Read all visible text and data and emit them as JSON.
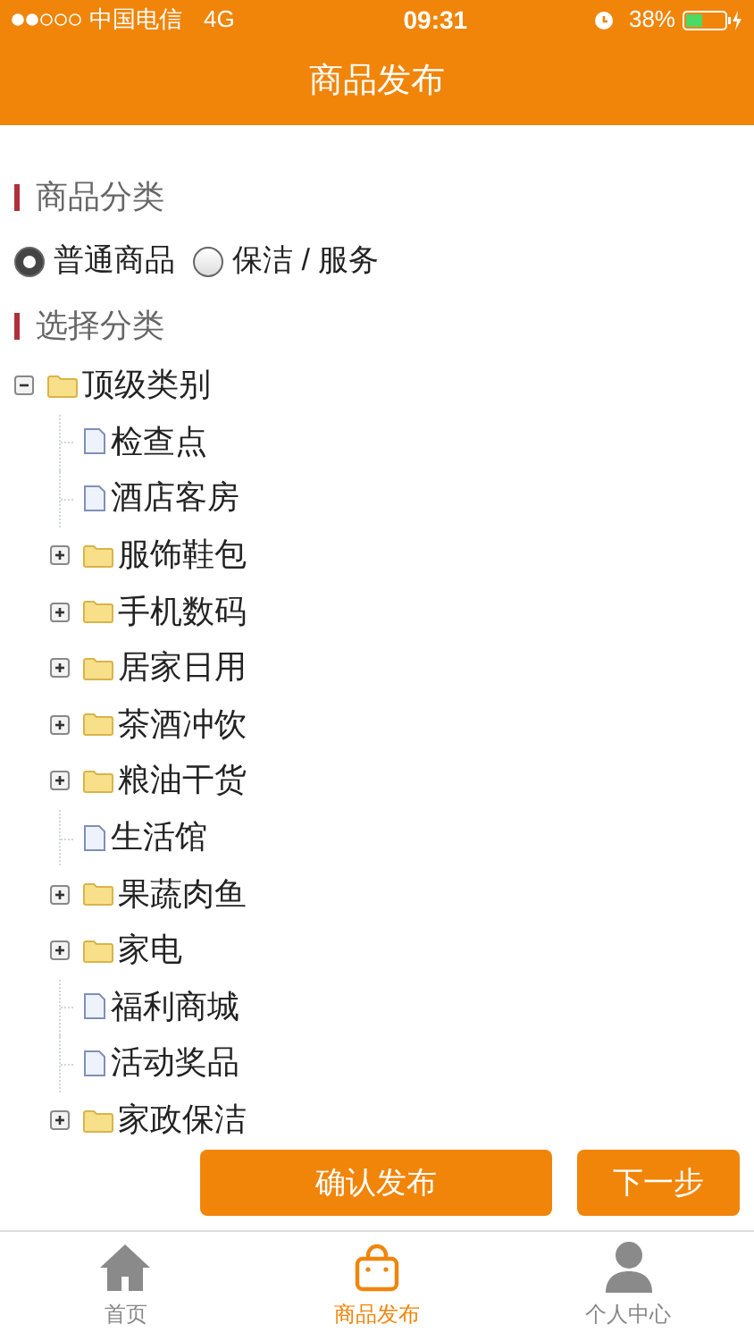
{
  "status_bar": {
    "carrier": "中国电信",
    "network": "4G",
    "time": "09:31",
    "battery": "38%"
  },
  "header": {
    "title": "商品发布"
  },
  "sections": [
    {
      "title": "商品分类"
    },
    {
      "title": "选择分类"
    }
  ],
  "radios": [
    {
      "label": "普通商品",
      "selected": true
    },
    {
      "label": "保洁 / 服务",
      "selected": false
    }
  ],
  "tree": {
    "label": "顶级类别",
    "kind": "folder",
    "expanded": true,
    "children": [
      {
        "label": "检查点",
        "kind": "file"
      },
      {
        "label": "酒店客房",
        "kind": "file"
      },
      {
        "label": "服饰鞋包",
        "kind": "folder",
        "expanded": false
      },
      {
        "label": "手机数码",
        "kind": "folder",
        "expanded": false
      },
      {
        "label": "居家日用",
        "kind": "folder",
        "expanded": false
      },
      {
        "label": "茶酒冲饮",
        "kind": "folder",
        "expanded": false
      },
      {
        "label": "粮油干货",
        "kind": "folder",
        "expanded": false
      },
      {
        "label": "生活馆",
        "kind": "file"
      },
      {
        "label": "果蔬肉鱼",
        "kind": "folder",
        "expanded": false
      },
      {
        "label": "家电",
        "kind": "folder",
        "expanded": false
      },
      {
        "label": "福利商城",
        "kind": "file"
      },
      {
        "label": "活动奖品",
        "kind": "file"
      },
      {
        "label": "家政保洁",
        "kind": "folder",
        "expanded": false
      }
    ]
  },
  "buttons": [
    {
      "label": "确认发布"
    },
    {
      "label": "下一步"
    }
  ],
  "tabs": [
    {
      "label": "首页",
      "selected": false
    },
    {
      "label": "商品发布",
      "selected": true
    },
    {
      "label": "个人中心",
      "selected": false
    }
  ]
}
